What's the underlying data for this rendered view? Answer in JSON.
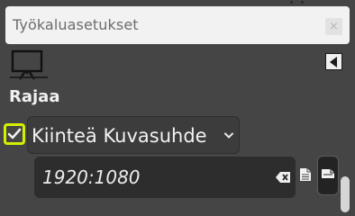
{
  "dialog": {
    "title": "Työkaluasetukset",
    "close_glyph": "×"
  },
  "tabs": {
    "active_icon": "tool-options-easel-icon",
    "menu_icon": "tab-menu-triangle-icon"
  },
  "tool_options": {
    "tool_name": "Rajaa",
    "fixed_checkbox_checked": true,
    "fixed_mode_label": "Kiinteä Kuvasuhde",
    "ratio_value": "1920:1080",
    "clear_icon": "clear-entry-icon",
    "portrait_icon": "portrait-orientation-icon",
    "landscape_icon": "landscape-orientation-icon"
  },
  "colors": {
    "background": "#454545",
    "titlebar": "#f2f2f2",
    "highlight": "#d4f000",
    "entry": "#2d2d2d"
  }
}
